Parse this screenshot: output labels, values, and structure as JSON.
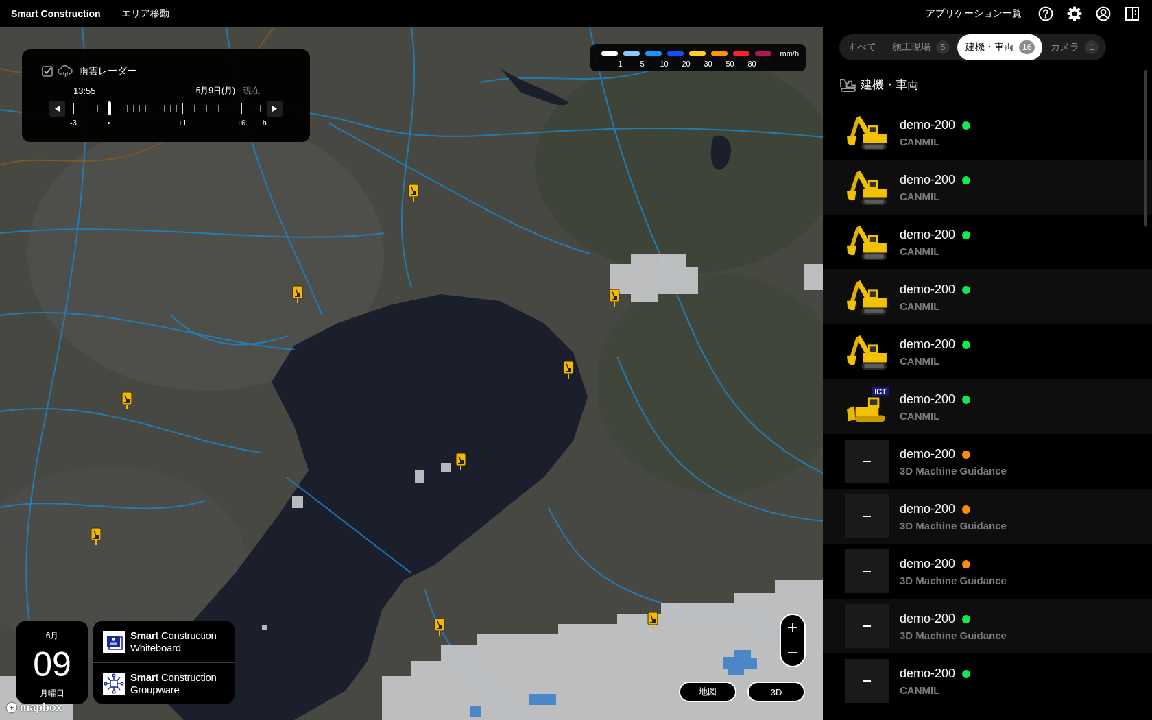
{
  "top_bar": {
    "brand": "Smart Construction",
    "area_menu": "エリア移動",
    "apps_link": "アプリケーション一覧"
  },
  "rain_radar": {
    "checked": true,
    "title": "雨雲レーダー",
    "time": "13:55",
    "date": "6月9日(月)",
    "status": "現在",
    "level": 0.19,
    "scale_labels": [
      "-3",
      "•",
      "+1",
      "+6",
      "h"
    ]
  },
  "legend": {
    "swatches": [
      {
        "color": "#ffffff"
      },
      {
        "color": "#8cc8ff"
      },
      {
        "color": "#1496ff"
      },
      {
        "color": "#1450ff"
      },
      {
        "color": "#ffd21e"
      },
      {
        "color": "#ff9600"
      },
      {
        "color": "#ff2020"
      },
      {
        "color": "#b4145a"
      }
    ],
    "labels": [
      "1",
      "5",
      "10",
      "20",
      "30",
      "50",
      "80"
    ],
    "unit": "mm/h"
  },
  "date_card": {
    "month": "6月",
    "day": "09",
    "weekday": "月曜日"
  },
  "apps": [
    {
      "kind": "whiteboard",
      "name": "**Smart** Construction Whiteboard"
    },
    {
      "kind": "groupware",
      "name": "**Smart** Construction Groupware"
    }
  ],
  "map_attribution": "mapbox",
  "view_buttons": [
    "地図",
    "3D"
  ],
  "panel": {
    "tabs": [
      {
        "label": "すべて",
        "selected": false
      },
      {
        "label": "施工現場",
        "count": "5",
        "selected": false
      },
      {
        "label": "建機・車両",
        "count": "16",
        "selected": true
      },
      {
        "label": "カメラ",
        "count": "1",
        "selected": false
      }
    ],
    "section_title": "建機・車両",
    "machines": [
      {
        "kind": "excavator",
        "name": "demo-200",
        "color": "#16e650",
        "type": "CANMIL"
      },
      {
        "kind": "excavator",
        "name": "demo-200",
        "color": "#16e650",
        "type": "CANMIL"
      },
      {
        "kind": "excavator",
        "name": "demo-200",
        "color": "#16e650",
        "type": "CANMIL"
      },
      {
        "kind": "excavator",
        "name": "demo-200",
        "color": "#16e650",
        "type": "CANMIL"
      },
      {
        "kind": "excavator",
        "name": "demo-200",
        "color": "#16e650",
        "type": "CANMIL"
      },
      {
        "kind": "bulldozer",
        "badge": "ICT",
        "name": "demo-200",
        "color": "#16e650",
        "type": "CANMIL"
      },
      {
        "kind": "none",
        "name": "demo-200",
        "color": "#ff8a0a",
        "type": "3D Machine Guidance"
      },
      {
        "kind": "none",
        "name": "demo-200",
        "color": "#ff8a0a",
        "type": "3D Machine Guidance"
      },
      {
        "kind": "none",
        "name": "demo-200",
        "color": "#ff8a0a",
        "type": "3D Machine Guidance"
      },
      {
        "kind": "none",
        "name": "demo-200",
        "color": "#16e650",
        "type": "3D Machine Guidance"
      },
      {
        "kind": "none",
        "name": "demo-200",
        "color": "#16e650",
        "type": "CANMIL"
      }
    ]
  }
}
